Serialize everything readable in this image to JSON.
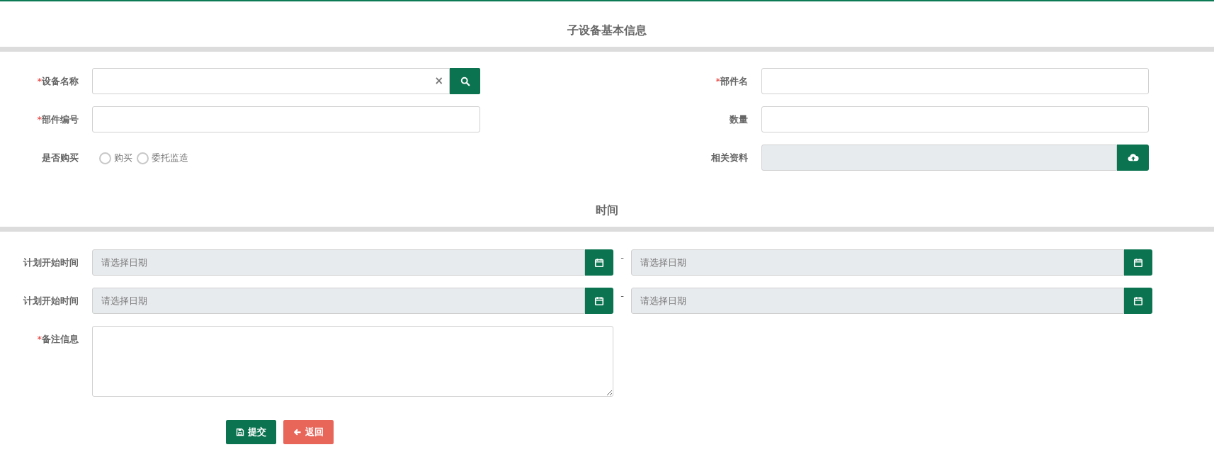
{
  "sections": [
    {
      "title": "子设备基本信息"
    },
    {
      "title": "时间"
    }
  ],
  "basic_left": [
    {
      "kind": "search",
      "mark": "*",
      "label": "设备名称",
      "clear": "×"
    },
    {
      "kind": "text",
      "mark": "*",
      "label": "部件编号"
    },
    {
      "kind": "radio",
      "label": "是否购买",
      "options": [
        {
          "label": "购买",
          "selected": false
        },
        {
          "label": "委托监造",
          "selected": false
        }
      ]
    }
  ],
  "basic_right": [
    {
      "kind": "text",
      "mark": "*",
      "label": "部件名"
    },
    {
      "kind": "text",
      "label": "数量"
    },
    {
      "kind": "upload",
      "label": "相关资料"
    }
  ],
  "date_rows": [
    {
      "label": "计划开始时间",
      "start": {
        "placeholder": "请选择日期"
      },
      "separator": "-",
      "end": {
        "placeholder": "请选择日期"
      }
    },
    {
      "label": "计划开始时间",
      "start": {
        "placeholder": "请选择日期"
      },
      "separator": "-",
      "end": {
        "placeholder": "请选择日期"
      }
    }
  ],
  "remarks": {
    "mark": "*",
    "label": "备注信息"
  },
  "buttons": [
    {
      "kind": "submit",
      "label": "提交"
    },
    {
      "kind": "back",
      "label": "返回"
    }
  ]
}
